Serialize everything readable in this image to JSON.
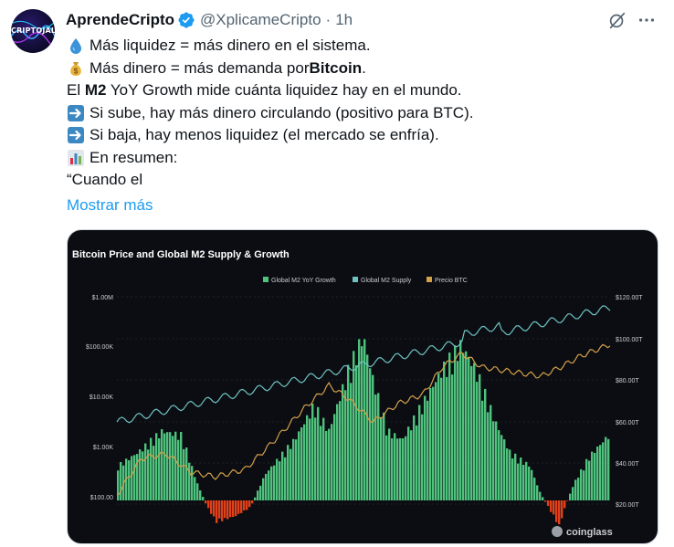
{
  "author": {
    "avatar_text": "CRIPTOJALD",
    "display_name": "AprendeCripto",
    "handle": "@XplicameCripto",
    "separator": "·",
    "time": "1h"
  },
  "icons": {
    "verified": "verified-badge-icon",
    "grok": "grok-slash-icon",
    "more": "more-dots-icon"
  },
  "body": {
    "line1": "Más liquidez = más dinero en el sistema.",
    "line2_pre": "Más dinero = más demanda por ",
    "line2_bold": "Bitcoin",
    "line2_post": ".",
    "line3_pre": "El ",
    "line3_bold": "M2",
    "line3_post": " YoY Growth mide cuánta liquidez hay en el mundo.",
    "line4": "Si sube, hay más dinero circulando (positivo para BTC).",
    "line5": "Si baja, hay menos liquidez (el mercado se enfría).",
    "line6": "En resumen:",
    "line7": "“Cuando el",
    "show_more": "Mostrar más"
  },
  "chart_data": {
    "type": "area",
    "title": "Bitcoin Price and Global M2 Supply & Growth",
    "legend": [
      "Global M2 YoY Growth",
      "Global M2 Supply",
      "Precio BTC"
    ],
    "legend_position": "top-center",
    "left_ticks": [
      "$1.00M",
      "$100.00K",
      "$10.00K",
      "$1.00K",
      "$100.00"
    ],
    "right_ticks": [
      "$120.00T",
      "$100.00T",
      "$80.00T",
      "$60.00T",
      "$40.00T",
      "$20.00T"
    ],
    "left_scale": "log",
    "watermark": "coinglass",
    "colors": {
      "growth_positive": "#4fc27e",
      "growth_negative": "#e0401a",
      "m2_supply": "#6ec3c1",
      "btc_price": "#d4a04a"
    }
  }
}
